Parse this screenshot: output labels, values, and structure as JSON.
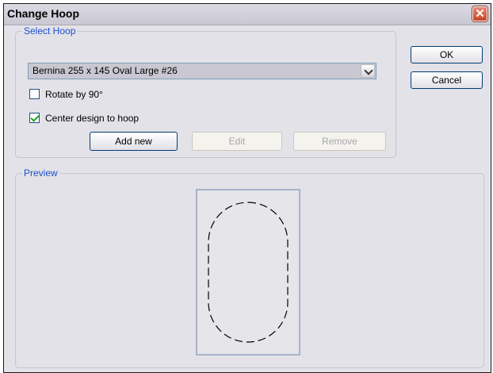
{
  "window": {
    "title": "Change Hoop"
  },
  "select_hoop": {
    "label": "Select Hoop",
    "selected_hoop": "Bernina 255 x 145 Oval Large #26",
    "rotate_label": "Rotate by 90°",
    "rotate_checked": false,
    "center_label": "Center design to hoop",
    "center_checked": true,
    "add_new_label": "Add new",
    "edit_label": "Edit",
    "remove_label": "Remove"
  },
  "buttons": {
    "ok_label": "OK",
    "cancel_label": "Cancel"
  },
  "preview": {
    "label": "Preview",
    "hoop_shape": "oval-dashed"
  },
  "icons": {
    "close": "close-icon",
    "dropdown": "chevron-down-icon",
    "check": "checkmark-icon"
  }
}
